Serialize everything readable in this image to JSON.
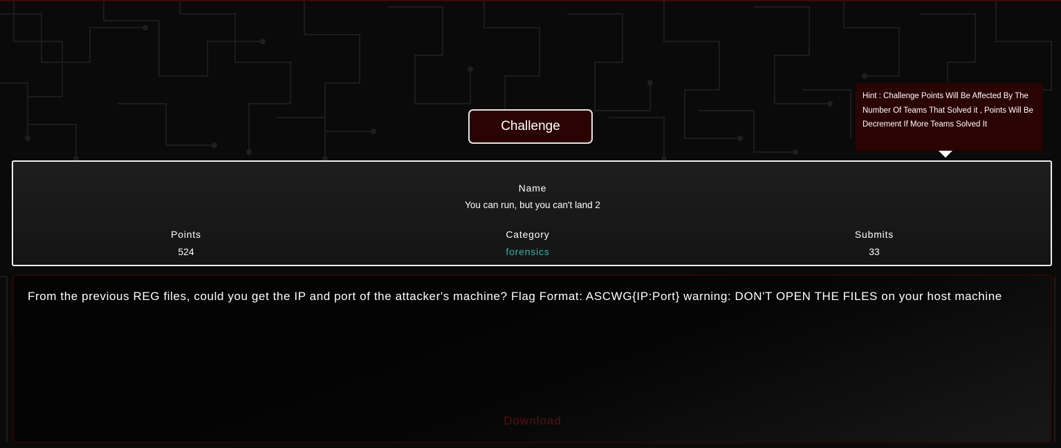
{
  "header": {
    "title_button_label": "Challenge"
  },
  "tooltip": {
    "text": "Hint : Challenge Points Will Be Affected By The Number Of Teams That Solved it , Points Will Be Decrement If More Teams Solved It"
  },
  "challenge": {
    "name_label": "Name",
    "name_value": "You can run, but you can't land 2",
    "points_label": "Points",
    "points_value": "524",
    "category_label": "Category",
    "category_value": "forensics",
    "submits_label": "Submits",
    "submits_value": "33"
  },
  "description": {
    "text": "From the previous REG files, could you get the IP and port of the attacker's machine? Flag Format: ASCWG{IP:Port} warning: DON'T OPEN THE FILES on your host machine",
    "download_label": "Download"
  },
  "colors": {
    "background": "#0a0a0a",
    "accent_dark_red": "#2a0303",
    "category_teal": "#35b5ad",
    "download_red": "#5a1010",
    "border_white": "#f0f0f0"
  },
  "icons": {
    "tooltip_pointer": "caret-down-icon",
    "background_pattern": "circuit-pattern"
  }
}
